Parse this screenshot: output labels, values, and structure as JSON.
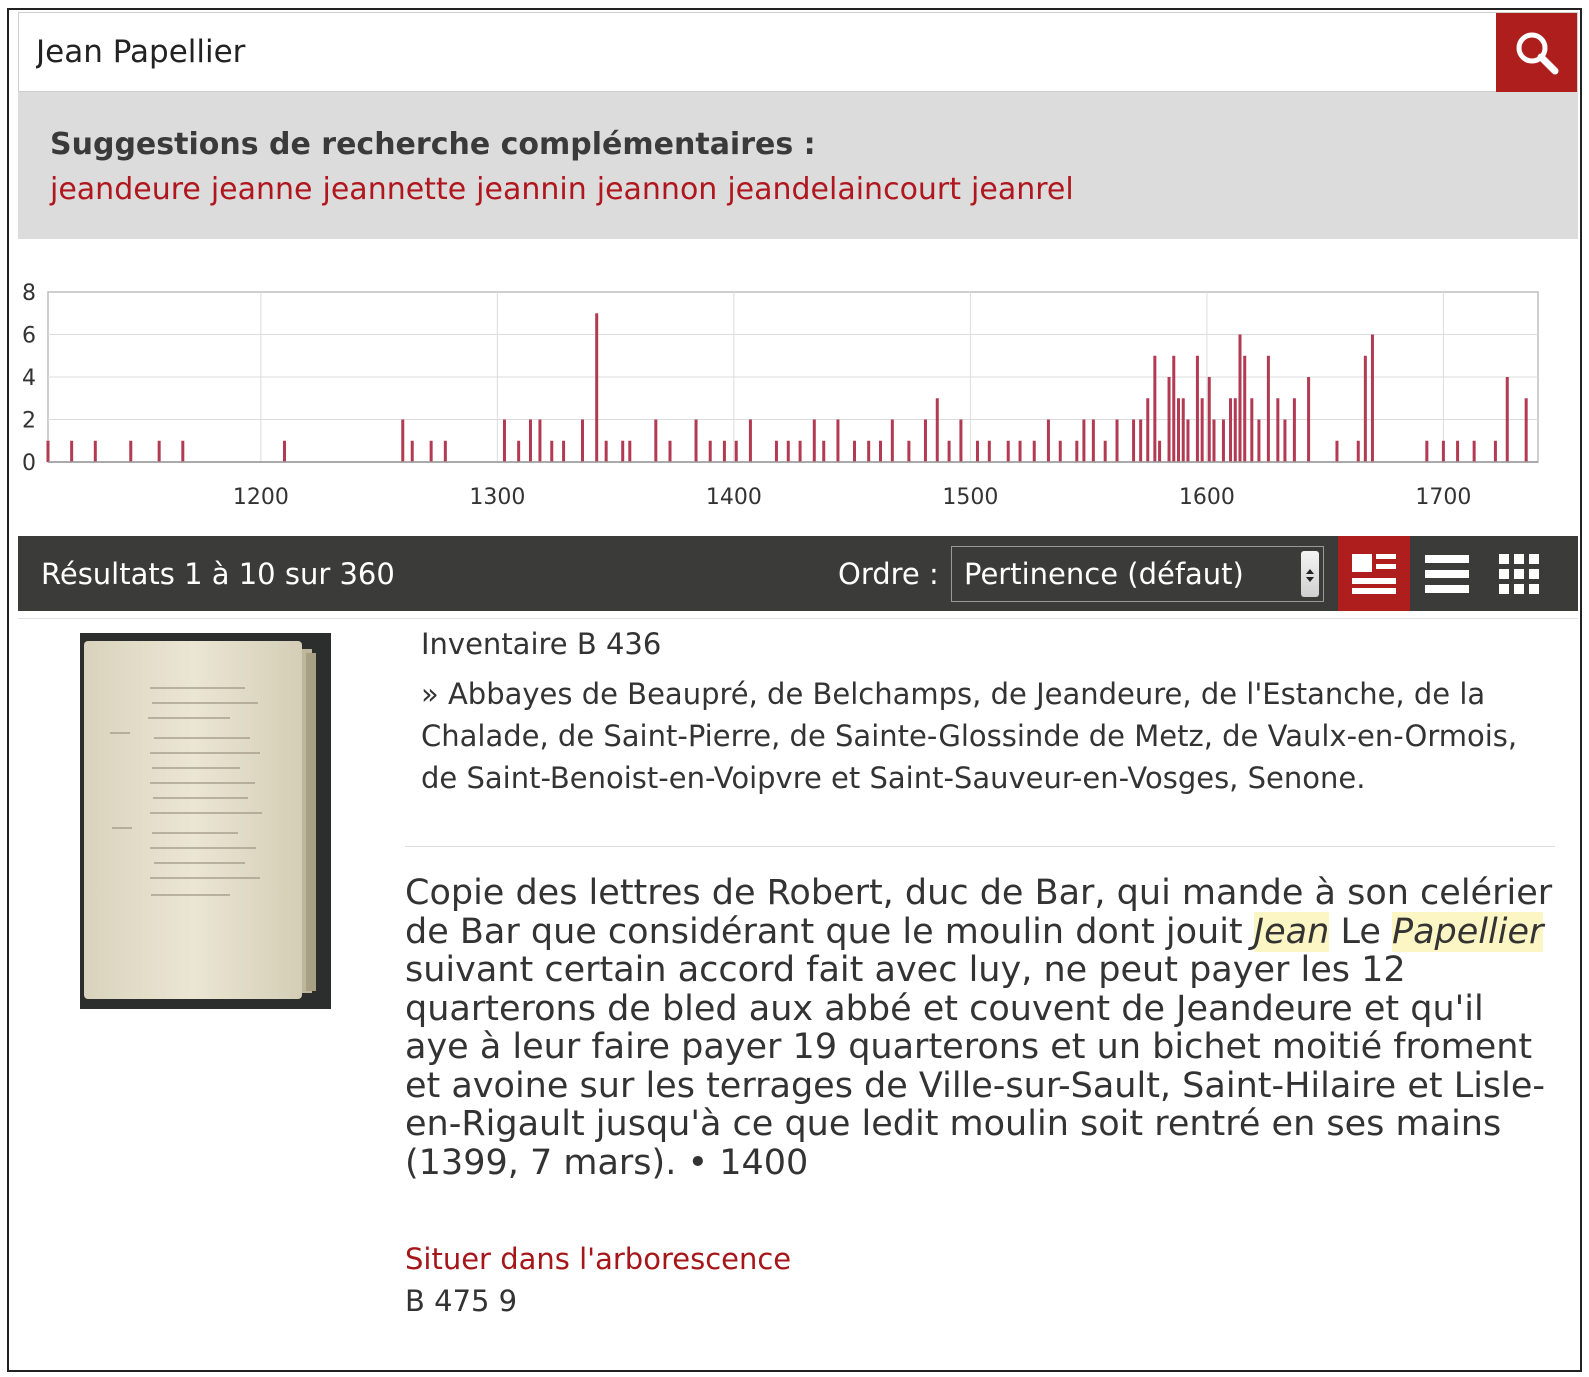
{
  "search": {
    "value": "Jean Papellier"
  },
  "suggestions": {
    "title": "Suggestions de recherche complémentaires :",
    "terms": [
      "jeandeure",
      "jeanne",
      "jeannette",
      "jeannin",
      "jeannon",
      "jeandelaincourt",
      "jeanrel"
    ]
  },
  "chart_data": {
    "type": "bar",
    "xlim": [
      1110,
      1740
    ],
    "ylim": [
      0,
      8
    ],
    "xticks": [
      "1200",
      "1300",
      "1400",
      "1500",
      "1600",
      "1700"
    ],
    "yticks": [
      "0",
      "2",
      "4",
      "6",
      "8"
    ],
    "grid": true,
    "bar_color": "#b23a52",
    "x": [
      1110,
      1120,
      1130,
      1145,
      1157,
      1167,
      1210,
      1260,
      1264,
      1272,
      1278,
      1303,
      1309,
      1314,
      1318,
      1323,
      1328,
      1336,
      1342,
      1346,
      1353,
      1356,
      1367,
      1373,
      1384,
      1390,
      1396,
      1401,
      1407,
      1418,
      1423,
      1428,
      1434,
      1438,
      1444,
      1451,
      1457,
      1462,
      1467,
      1474,
      1481,
      1486,
      1491,
      1496,
      1503,
      1508,
      1516,
      1521,
      1527,
      1533,
      1538,
      1545,
      1548,
      1552,
      1557,
      1562,
      1569,
      1572,
      1575,
      1578,
      1580,
      1584,
      1586,
      1588,
      1590,
      1592,
      1596,
      1598,
      1601,
      1603,
      1607,
      1610,
      1612,
      1614,
      1616,
      1619,
      1622,
      1626,
      1630,
      1633,
      1637,
      1643,
      1655,
      1664,
      1667,
      1670,
      1693,
      1700,
      1706,
      1713,
      1722,
      1727,
      1735
    ],
    "values": [
      1,
      1,
      1,
      1,
      1,
      1,
      1,
      2,
      1,
      1,
      1,
      2,
      1,
      2,
      2,
      1,
      1,
      2,
      7,
      1,
      1,
      1,
      2,
      1,
      2,
      1,
      1,
      1,
      2,
      1,
      1,
      1,
      2,
      1,
      2,
      1,
      1,
      1,
      2,
      1,
      2,
      3,
      1,
      2,
      1,
      1,
      1,
      1,
      1,
      2,
      1,
      1,
      2,
      2,
      1,
      2,
      2,
      2,
      3,
      5,
      1,
      4,
      5,
      3,
      3,
      2,
      5,
      3,
      4,
      2,
      2,
      3,
      3,
      6,
      5,
      3,
      2,
      5,
      3,
      2,
      3,
      4,
      1,
      1,
      5,
      6,
      1,
      1,
      1,
      1,
      1,
      4,
      3
    ]
  },
  "results": {
    "count_text": "Résultats 1 à 10 sur 360",
    "order_label": "Ordre :",
    "order_value": "Pertinence (défaut)"
  },
  "record": {
    "inventaire": "Inventaire B 436",
    "abbayes": "» Abbayes de Beaupré, de Belchamps, de Jeandeure, de l'Estanche, de la Chalade, de Saint-Pierre, de Sainte-Glossinde de Metz, de Vaulx-en-Ormois, de Saint-Benoist-en-Voipvre et Saint-Sauveur-en-Vosges, Senone.",
    "desc_1": "Copie des lettres de Robert, duc de Bar, qui mande à son celérier de Bar que considérant que le moulin dont jouit",
    "hl_1": "Jean",
    "desc_2": "Le",
    "hl_2": "Papellier",
    "desc_3": "suivant certain accord fait avec luy, ne peut payer les 12 quarterons de bled aux abbé et couvent de Jeandeure et qu'il aye à leur faire payer 19 quarterons et un bichet moitié froment et avoine sur les terrages de Ville-sur-Sault, Saint-Hilaire et Lisle-en-Rigault jusqu'à ce que ledit moulin soit rentré en ses mains (1399, 7 mars). • 1400",
    "situer_link": "Situer dans l'arborescence",
    "cote": "B 475 9"
  }
}
